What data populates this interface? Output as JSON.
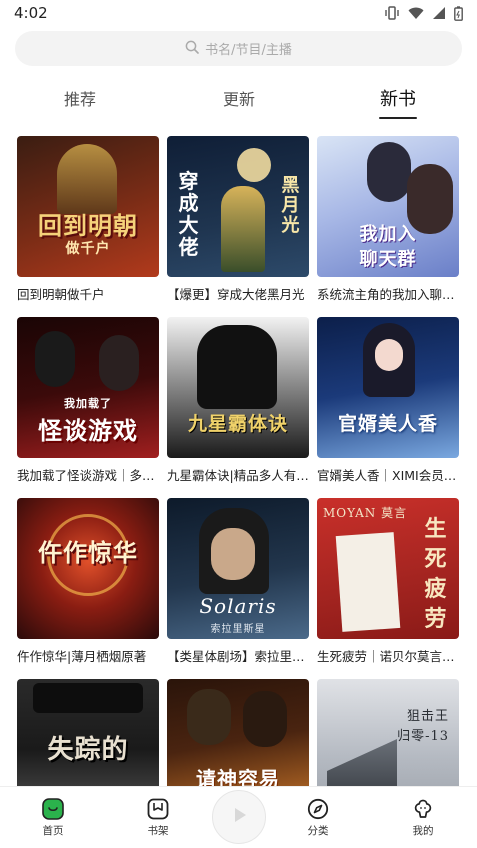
{
  "status_bar": {
    "time": "4:02"
  },
  "search": {
    "placeholder": "书名/节目/主播"
  },
  "tabs": [
    {
      "label": "推荐",
      "active": false
    },
    {
      "label": "更新",
      "active": false
    },
    {
      "label": "新书",
      "active": true
    }
  ],
  "books": [
    {
      "title": "回到明朝做千户",
      "cover_text": "回到明朝",
      "cover_sub": "做千户",
      "cover_colors": [
        "#3a1d12",
        "#b23a1c"
      ]
    },
    {
      "title": "【爆更】穿成大佬黑月光",
      "cover_text": "穿成大佬",
      "cover_sub": "黑月光",
      "cover_colors": [
        "#0f1e36",
        "#2d4a6a"
      ]
    },
    {
      "title": "系统流主角的我加入聊天群",
      "cover_text": "我加入",
      "cover_sub": "聊天群",
      "cover_colors": [
        "#6a7fc8",
        "#d7b6e6"
      ]
    },
    {
      "title": "我加载了怪谈游戏｜多人有声剧",
      "cover_text": "怪谈游戏",
      "cover_sub": "我加载了",
      "cover_colors": [
        "#3b0a0a",
        "#a11f1f"
      ]
    },
    {
      "title": "九星霸体诀|精品多人有声剧",
      "cover_text": "九星霸体诀",
      "cover_sub": "",
      "cover_colors": [
        "#111111",
        "#5a5a5a"
      ]
    },
    {
      "title": "官婿美人香｜XIMI会员精品",
      "cover_text": "官婿美人香",
      "cover_sub": "",
      "cover_colors": [
        "#1b3a7a",
        "#7aa8e0"
      ]
    },
    {
      "title": "仵作惊华|薄月栖烟原著",
      "cover_text": "仵作惊华",
      "cover_sub": "",
      "cover_colors": [
        "#2a0a0a",
        "#c0341d"
      ]
    },
    {
      "title": "【类星体剧场】索拉里斯星",
      "cover_text": "Solaris",
      "cover_sub": "索拉里斯星",
      "cover_colors": [
        "#0d1a2a",
        "#4b6a8a"
      ]
    },
    {
      "title": "生死疲劳｜诺贝尔莫言作品",
      "cover_text": "生死疲劳",
      "cover_sub": "MOYAN 莫言",
      "cover_colors": [
        "#8a1a17",
        "#c9302a"
      ]
    },
    {
      "title": "失踪的",
      "cover_text": "失踪的",
      "cover_sub": "",
      "cover_colors": [
        "#1a1a1a",
        "#555555"
      ]
    },
    {
      "title": "请神容易",
      "cover_text": "请神容易",
      "cover_sub": "",
      "cover_colors": [
        "#4a2410",
        "#d07a2a"
      ]
    },
    {
      "title": "狙击王 归零-13",
      "cover_text": "狙击王",
      "cover_sub": "归零-13",
      "cover_colors": [
        "#9aa0a8",
        "#e0e2e6"
      ]
    }
  ],
  "bottom_nav": [
    {
      "label": "首页",
      "icon": "home-icon"
    },
    {
      "label": "书架",
      "icon": "bookshelf-icon"
    },
    {
      "label": "分类",
      "icon": "compass-icon"
    },
    {
      "label": "我的",
      "icon": "profile-icon"
    }
  ],
  "colors": {
    "accent": "#2bb24c",
    "text": "#222222",
    "search_bg": "#f3f3f3"
  }
}
